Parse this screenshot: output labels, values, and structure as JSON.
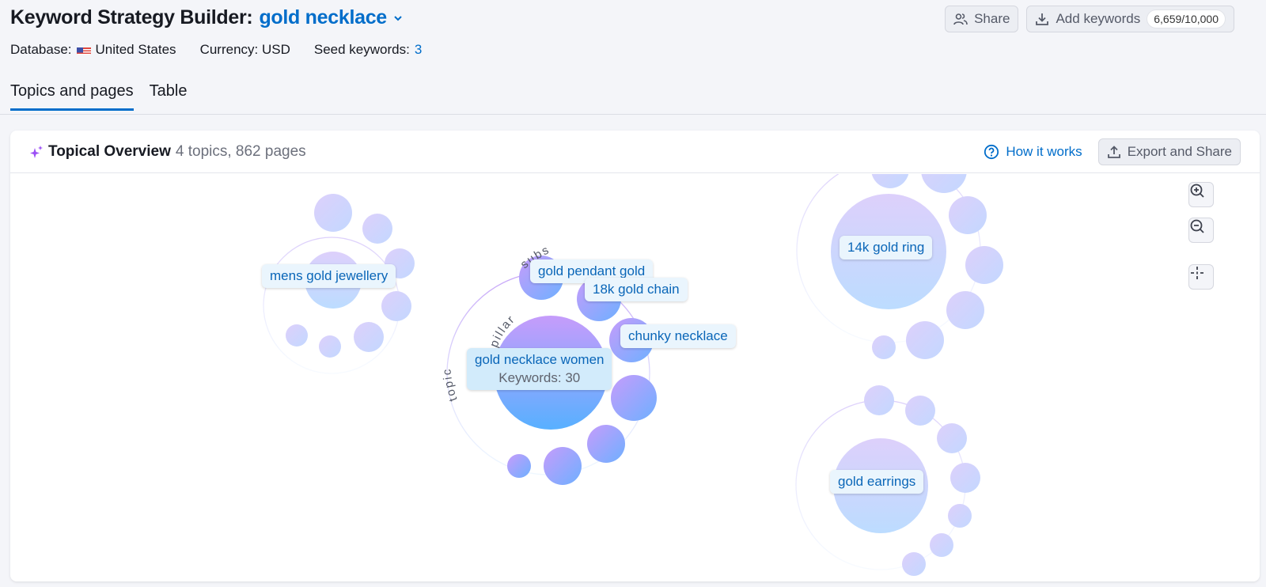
{
  "header": {
    "title_prefix": "Keyword Strategy Builder:",
    "seed_title": "gold necklace",
    "database_label": "Database:",
    "database_value": "United States",
    "currency": "Currency: USD",
    "seed_keywords_label": "Seed keywords:",
    "seed_keywords_count": "3"
  },
  "actions": {
    "share": "Share",
    "add_keywords": "Add keywords",
    "keyword_quota": "6,659/10,000"
  },
  "tabs": [
    {
      "label": "Topics and pages",
      "active": true
    },
    {
      "label": "Table",
      "active": false
    }
  ],
  "card": {
    "title": "Topical Overview",
    "summary": "4 topics, 862 pages",
    "how_it_works": "How it works",
    "export": "Export and Share"
  },
  "graph": {
    "arc_labels": {
      "subs": "subs",
      "topic": "topic",
      "pillar": "pillar"
    },
    "topics": [
      {
        "name": "mens gold jewellery",
        "active": false
      },
      {
        "name": "gold necklace women",
        "active": true,
        "keywords_label": "Keywords: 30",
        "subtopics": [
          "gold pendant gold",
          "18k gold chain",
          "chunky necklace"
        ]
      },
      {
        "name": "14k gold ring",
        "active": false
      },
      {
        "name": "gold earrings",
        "active": false
      }
    ]
  },
  "colors": {
    "accent": "#006dca",
    "active_grad_top": "#c69cfb",
    "active_grad_bottom": "#58b0ff",
    "muted_grad_top": "#ddd0fb",
    "muted_grad_bottom": "#bcdcff"
  }
}
